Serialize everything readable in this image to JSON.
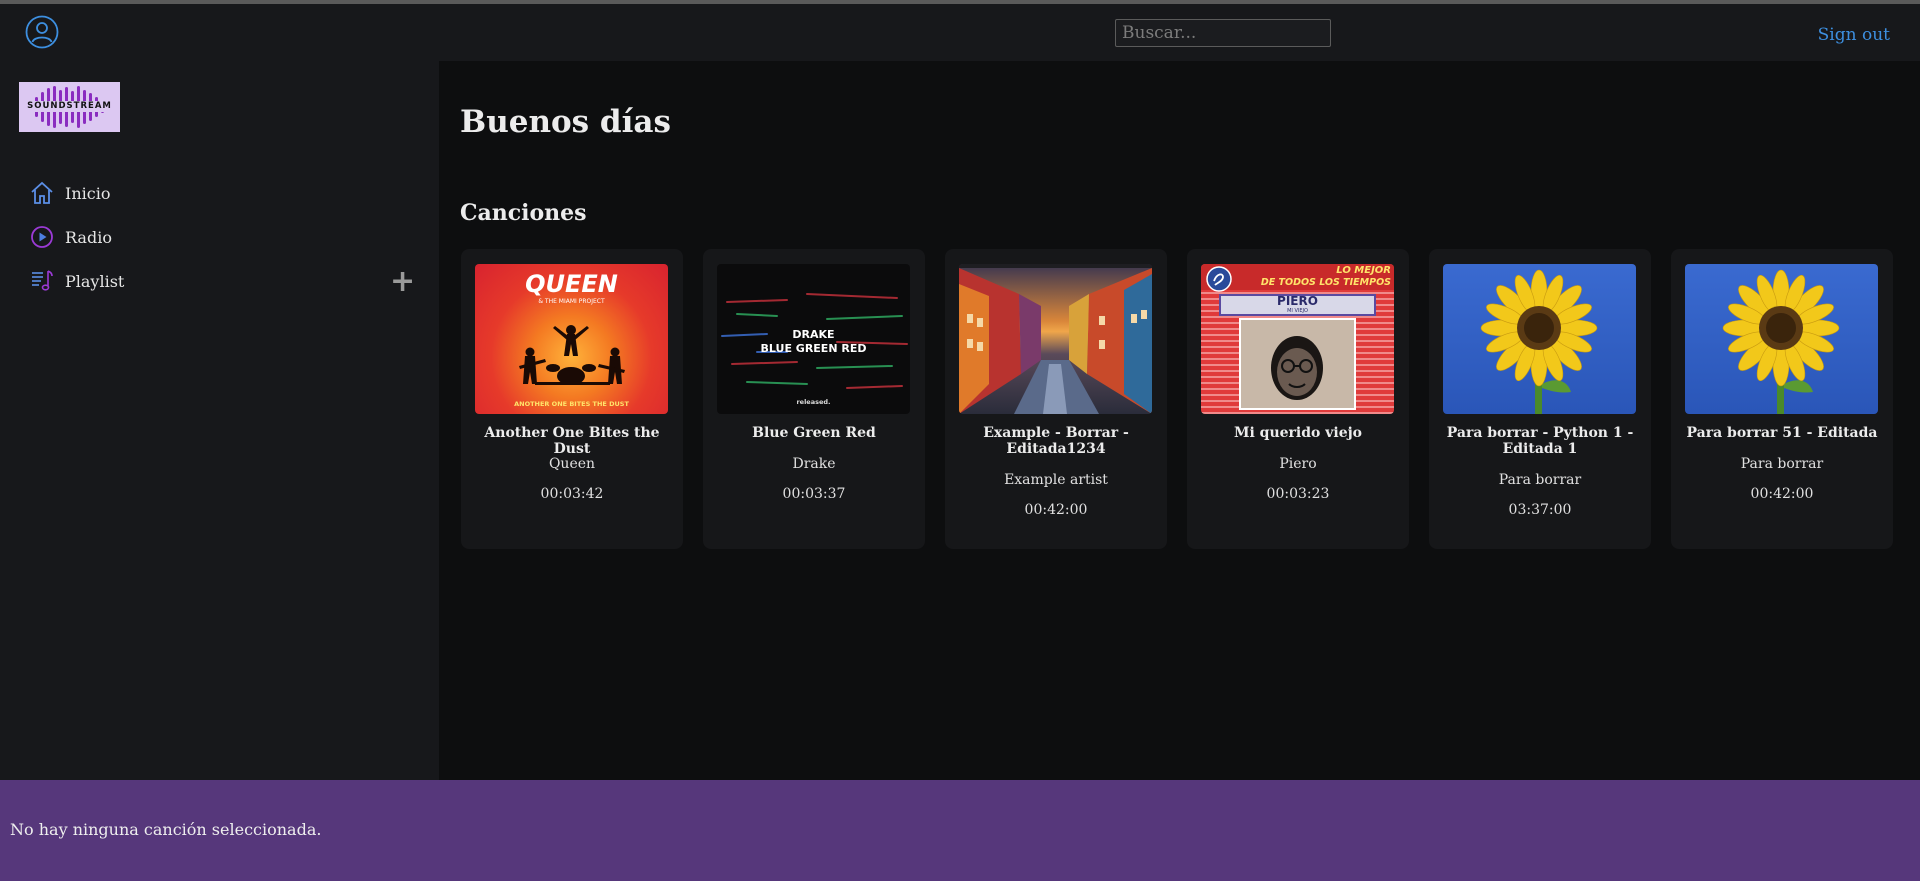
{
  "header": {
    "search_placeholder": "Buscar...",
    "sign_out": "Sign out"
  },
  "sidebar": {
    "logo_text": "SOUNDSTREAM",
    "items": [
      {
        "label": "Inicio",
        "icon": "home-icon"
      },
      {
        "label": "Radio",
        "icon": "play-circle-icon"
      },
      {
        "label": "Playlist",
        "icon": "playlist-icon"
      }
    ],
    "add_icon": "plus-icon"
  },
  "main": {
    "greeting": "Buenos días",
    "section_title": "Canciones",
    "songs": [
      {
        "title": "Another One Bites the Dust",
        "artist": "Queen",
        "duration": "00:03:42",
        "cover_text_1": "QUEEN",
        "cover_text_2": "& THE MIAMI PROJECT",
        "cover_text_3": "ANOTHER ONE BITES THE DUST"
      },
      {
        "title": "Blue Green Red",
        "artist": "Drake",
        "duration": "00:03:37",
        "cover_text_1": "DRAKE",
        "cover_text_2": "BLUE GREEN RED",
        "cover_text_3": "released."
      },
      {
        "title": "Example - Borrar - Editada1234",
        "artist": "Example artist",
        "duration": "00:42:00"
      },
      {
        "title": "Mi querido viejo",
        "artist": "Piero",
        "duration": "00:03:23",
        "cover_text_1": "LO MEJOR",
        "cover_text_2": "DE TODOS LOS TIEMPOS",
        "cover_text_3": "PIERO",
        "cover_text_4": "MI VIEJO"
      },
      {
        "title": "Para borrar - Python 1 - Editada 1",
        "artist": "Para borrar",
        "duration": "03:37:00"
      },
      {
        "title": "Para borrar 51 - Editada",
        "artist": "Para borrar",
        "duration": "00:42:00"
      }
    ]
  },
  "player": {
    "message": "No hay ninguna canción seleccionada."
  },
  "colors": {
    "accent_link": "#3d8fe0",
    "player_bg": "#56377b",
    "sidebar_bg": "#17181b",
    "main_bg": "#0d0e0f"
  }
}
